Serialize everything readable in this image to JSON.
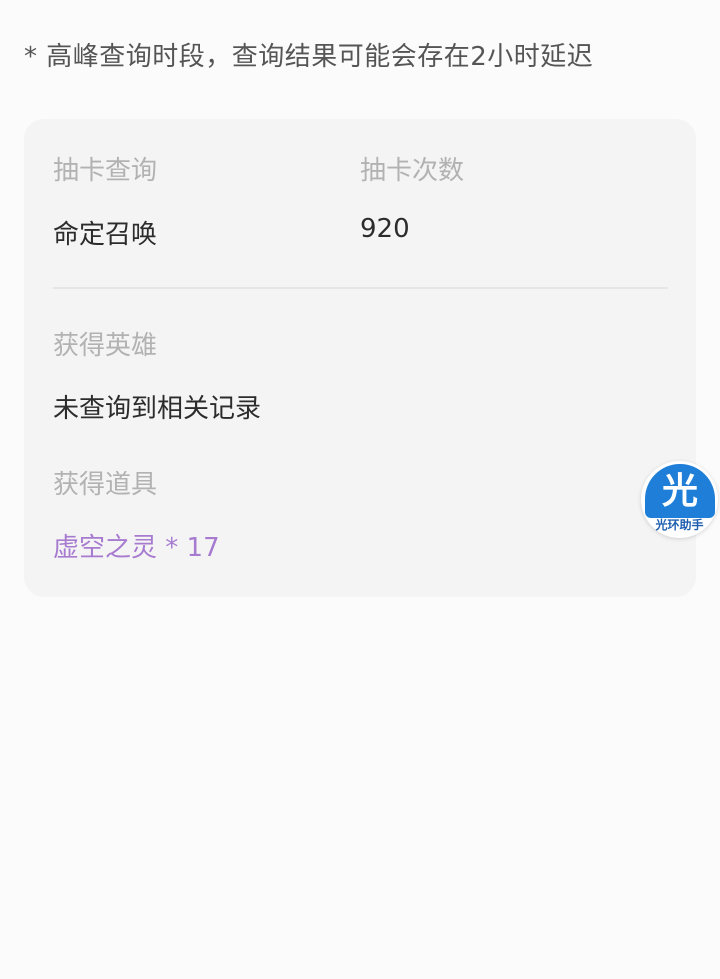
{
  "notice": "* 高峰查询时段，查询结果可能会存在2小时延迟",
  "card": {
    "draw_label": "抽卡查询",
    "count_label": "抽卡次数",
    "draw_value": "命定召唤",
    "count_value": "920",
    "heroes_label": "获得英雄",
    "heroes_value": "未查询到相关记录",
    "items_label": "获得道具",
    "items_value": "虚空之灵 * 17"
  },
  "float_button": {
    "glyph": "光",
    "caption": "光环助手",
    "icon": "halo-assistant-icon",
    "color": "#1f7fd8"
  },
  "colors": {
    "item_accent": "#a77bd0",
    "label": "#b2b2b2",
    "value": "#2c2c2c"
  }
}
